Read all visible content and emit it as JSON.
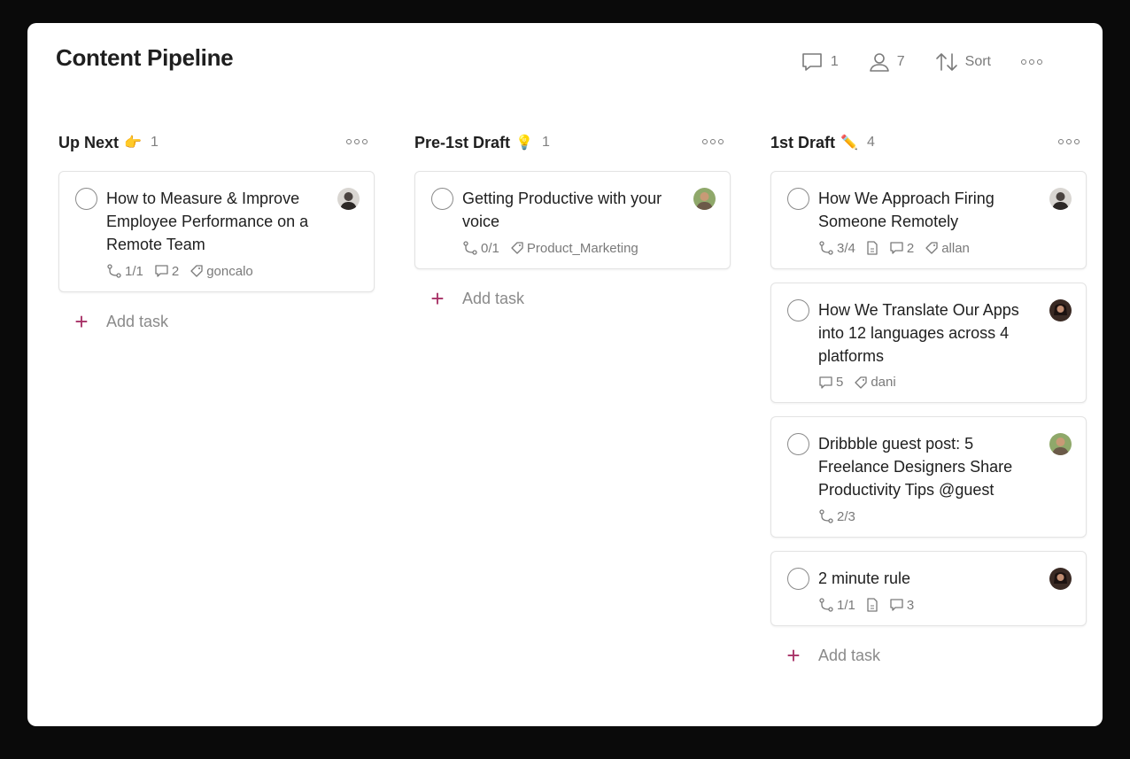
{
  "page": {
    "title": "Content Pipeline"
  },
  "header": {
    "comments_count": "1",
    "people_count": "7",
    "sort_label": "Sort"
  },
  "columns": [
    {
      "title": "Up Next",
      "emoji": "👉",
      "count": "1",
      "add_task_label": "Add task",
      "cards": [
        {
          "title": "How to Measure & Improve Employee Performance on a Remote Team",
          "subtasks": "1/1",
          "comments": "2",
          "label": "goncalo"
        }
      ]
    },
    {
      "title": "Pre-1st Draft",
      "emoji": "💡",
      "count": "1",
      "add_task_label": "Add task",
      "cards": [
        {
          "title": "Getting Productive with your voice",
          "subtasks": "0/1",
          "label": "Product_Marketing"
        }
      ]
    },
    {
      "title": "1st Draft",
      "emoji": "✏️",
      "count": "4",
      "add_task_label": "Add task",
      "cards": [
        {
          "title": "How We Approach Firing Someone Remotely",
          "subtasks": "3/4",
          "comments": "2",
          "label": "allan"
        },
        {
          "title": "How We Translate Our Apps into 12 languages across 4 platforms",
          "comments": "5",
          "label": "dani"
        },
        {
          "title": "Dribbble guest post: 5 Freelance Designers Share Productivity Tips @guest",
          "subtasks": "2/3"
        },
        {
          "title": "2 minute rule",
          "subtasks": "1/1",
          "comments": "3"
        }
      ]
    }
  ],
  "colors": {
    "accent": "#a83267",
    "muted": "#7a7a7a"
  }
}
